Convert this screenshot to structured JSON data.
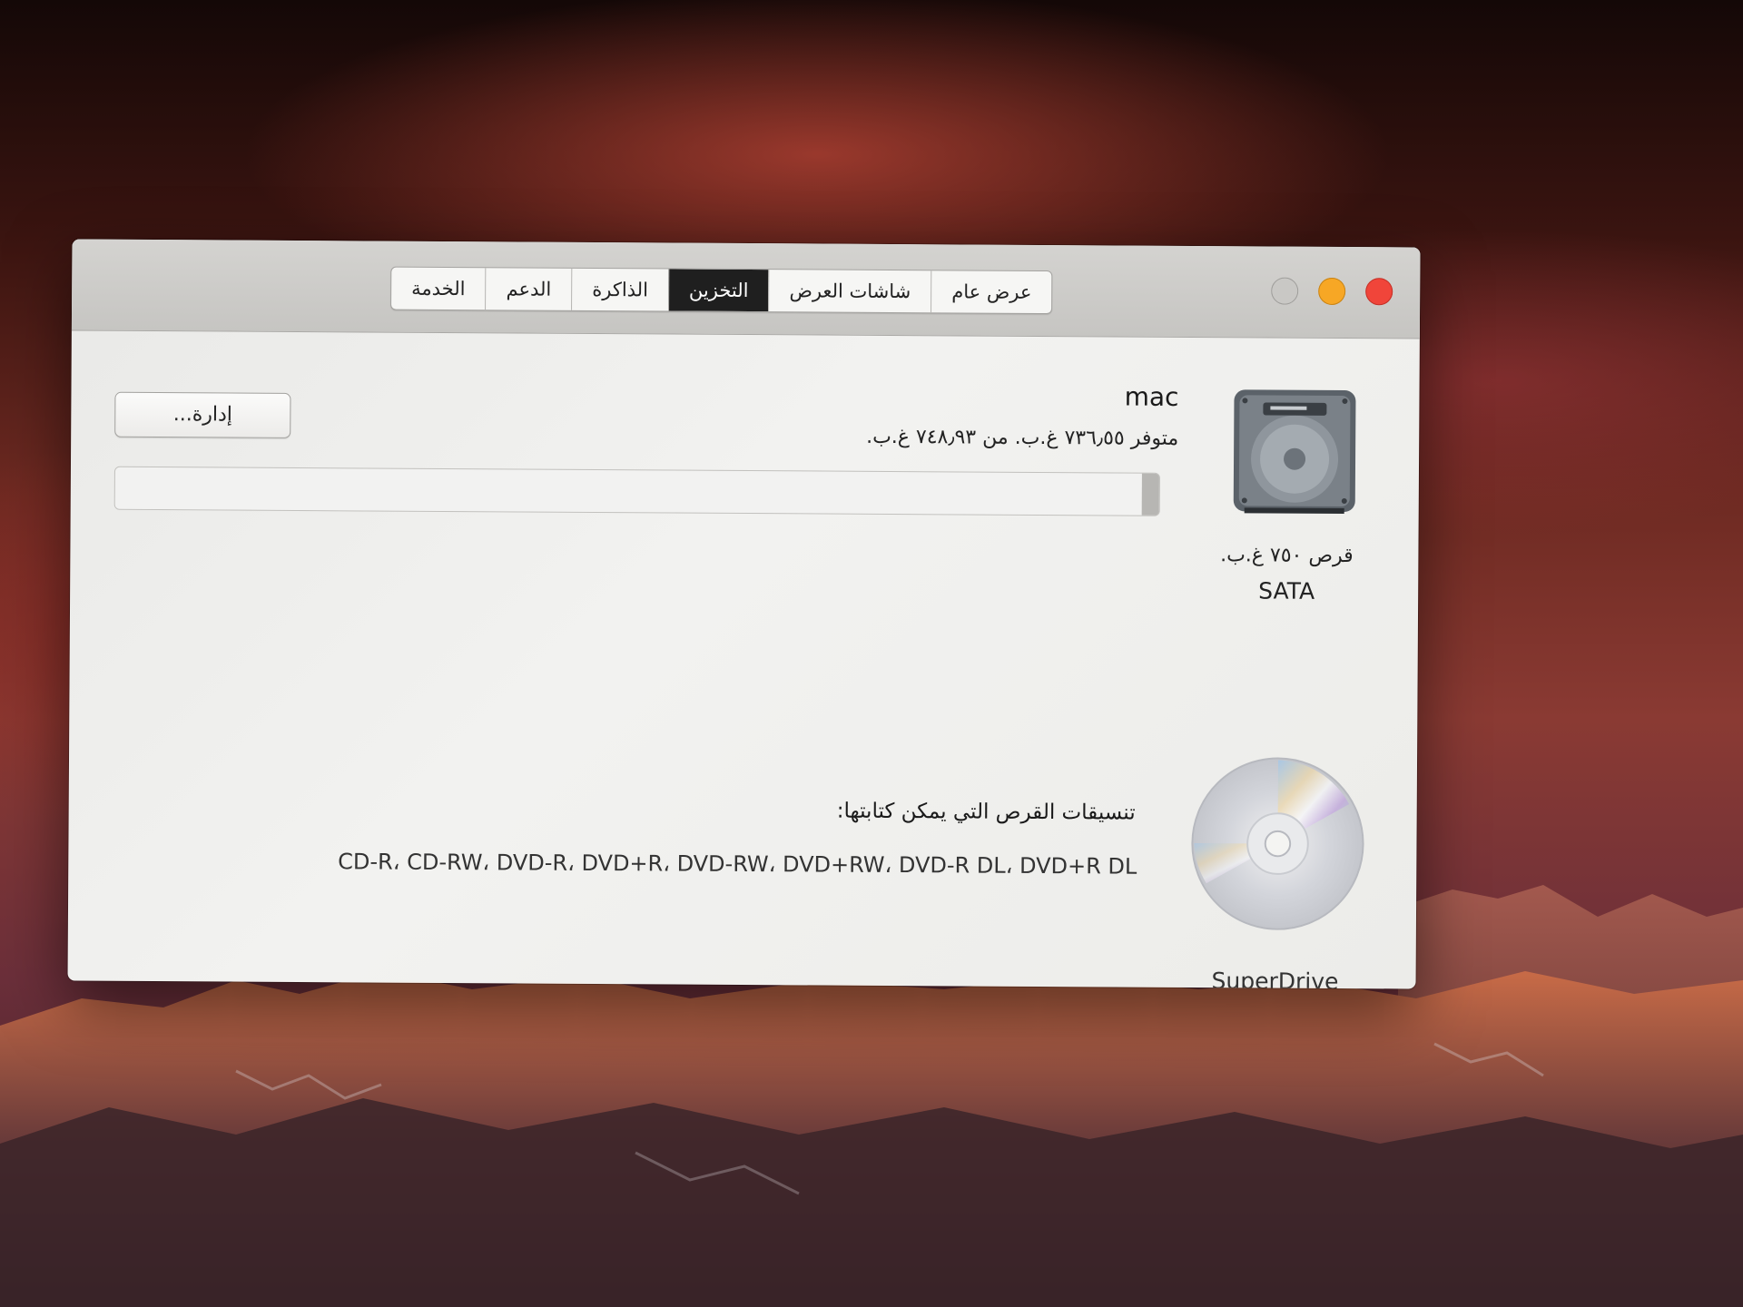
{
  "window": {
    "controls": {
      "close": {
        "color": "#f0453a"
      },
      "minimize": {
        "color": "#f7a725"
      },
      "zoom": {
        "color": "#c9c8c5"
      }
    },
    "tabs": [
      {
        "label": "عرض عام",
        "active": false
      },
      {
        "label": "شاشات العرض",
        "active": false
      },
      {
        "label": "التخزين",
        "active": true
      },
      {
        "label": "الذاكرة",
        "active": false
      },
      {
        "label": "الدعم",
        "active": false
      },
      {
        "label": "الخدمة",
        "active": false
      }
    ]
  },
  "storage": {
    "disk": {
      "icon": "hard-drive-icon",
      "size_label": "قرص ٧٥٠ غ.ب.",
      "type_label": "SATA"
    },
    "volume": {
      "name": "mac",
      "availability": "متوفر ٧٣٦٫٥٥ غ.ب. من ٧٤٨٫٩٣ غ.ب.",
      "used_fraction": 0.0166
    },
    "manage_button": "إدارة...",
    "optical_drive": {
      "icon": "disc-icon",
      "name": "SuperDrive",
      "formats_label": "تنسيقات القرص التي يمكن كتابتها:",
      "formats": "CD-R، CD-RW، DVD-R، DVD+R، DVD-RW، DVD+RW، DVD-R DL، DVD+R DL"
    }
  },
  "colors": {
    "active_tab_bg": "#1f1f1f",
    "window_bg": "#ececea",
    "titlebar_bg": "#c9c8c5"
  }
}
